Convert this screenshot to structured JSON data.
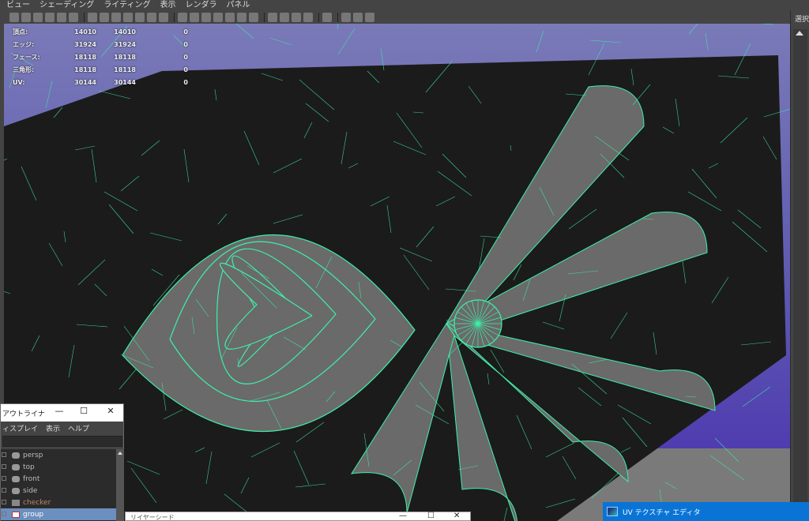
{
  "menubar": {
    "items": [
      "ビュー",
      "シェーディング",
      "ライティング",
      "表示",
      "レンダラ",
      "パネル"
    ]
  },
  "hud": {
    "rows": [
      {
        "label": "頂点:",
        "value": "14010",
        "selected": "14010",
        "extra": "0"
      },
      {
        "label": "エッジ:",
        "value": "31924",
        "selected": "31924",
        "extra": "0"
      },
      {
        "label": "フェース:",
        "value": "18118",
        "selected": "18118",
        "extra": "0"
      },
      {
        "label": "三角形:",
        "value": "18118",
        "selected": "18118",
        "extra": "0"
      },
      {
        "label": "UV:",
        "value": "30144",
        "selected": "30144",
        "extra": "0"
      }
    ]
  },
  "right_panel": {
    "title": "選択"
  },
  "outliner": {
    "title": "アウトライナ",
    "minimize": "—",
    "maximize": "☐",
    "close": "✕",
    "menu": [
      "ィスプレイ",
      "表示",
      "ヘルプ"
    ],
    "items": [
      {
        "label": "persp",
        "selected": false,
        "dim": false
      },
      {
        "label": "top",
        "selected": false,
        "dim": false
      },
      {
        "label": "front",
        "selected": false,
        "dim": false
      },
      {
        "label": "side",
        "selected": false,
        "dim": false
      },
      {
        "label": "checker",
        "selected": false,
        "dim": true
      },
      {
        "label": "group",
        "selected": true,
        "dim": false
      }
    ]
  },
  "layer_editor": {
    "title": "リイヤーシード",
    "minimize": "—",
    "maximize": "☐",
    "close": "✕"
  },
  "uv_editor": {
    "title": "UV テクスチャ エディタ"
  },
  "colors": {
    "wire": "#3df0a8",
    "mesh": "#6a6a6a",
    "bg_top": "#7a7ab8",
    "bg_bottom": "#4a2fb0",
    "taskbar": "#0a74d6"
  }
}
